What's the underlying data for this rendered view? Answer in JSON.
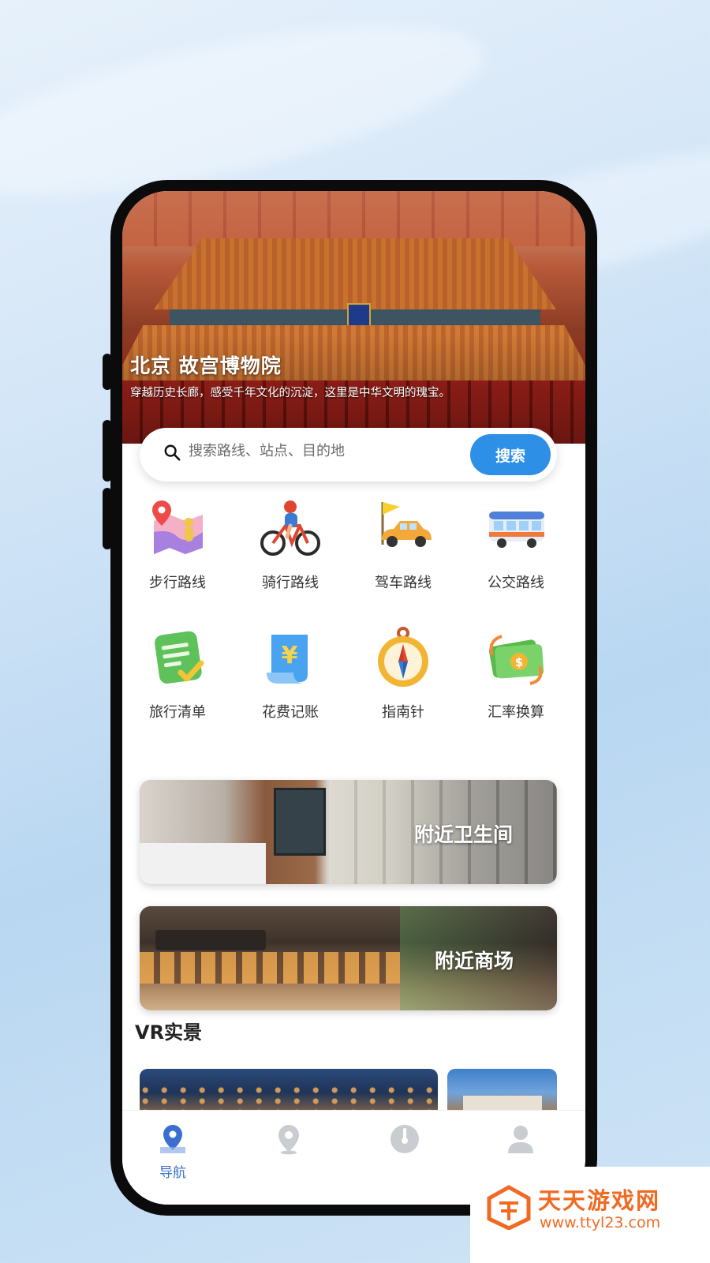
{
  "hero": {
    "title": "北京 故宫博物院",
    "subtitle": "穿越历史长廊，感受千年文化的沉淀，这里是中华文明的瑰宝。"
  },
  "search": {
    "placeholder": "搜索路线、站点、目的地",
    "button_label": "搜索"
  },
  "tools": [
    {
      "label": "步行路线",
      "icon": "map-pin-icon"
    },
    {
      "label": "骑行路线",
      "icon": "cyclist-icon"
    },
    {
      "label": "驾车路线",
      "icon": "car-flag-icon"
    },
    {
      "label": "公交路线",
      "icon": "bus-icon"
    },
    {
      "label": "旅行清单",
      "icon": "checklist-icon"
    },
    {
      "label": "花费记账",
      "icon": "yuan-receipt-icon"
    },
    {
      "label": "指南针",
      "icon": "compass-icon"
    },
    {
      "label": "汇率换算",
      "icon": "money-exchange-icon"
    }
  ],
  "cards": [
    {
      "label": "附近卫生间"
    },
    {
      "label": "附近商场"
    }
  ],
  "vr": {
    "title": "VR实景"
  },
  "tabbar": {
    "tabs": [
      {
        "label": "导航",
        "icon": "navigation-pin-icon",
        "active": true
      },
      {
        "label": "",
        "icon": "location-icon",
        "active": false
      },
      {
        "label": "",
        "icon": "compass-dial-icon",
        "active": false
      },
      {
        "label": "",
        "icon": "user-icon",
        "active": false
      }
    ]
  },
  "colors": {
    "accent": "#2e8fe6",
    "tab_active": "#3b6fcf",
    "watermark": "#f06a22"
  },
  "watermark": {
    "title": "天天游戏网",
    "url": "www.ttyl23.com"
  }
}
